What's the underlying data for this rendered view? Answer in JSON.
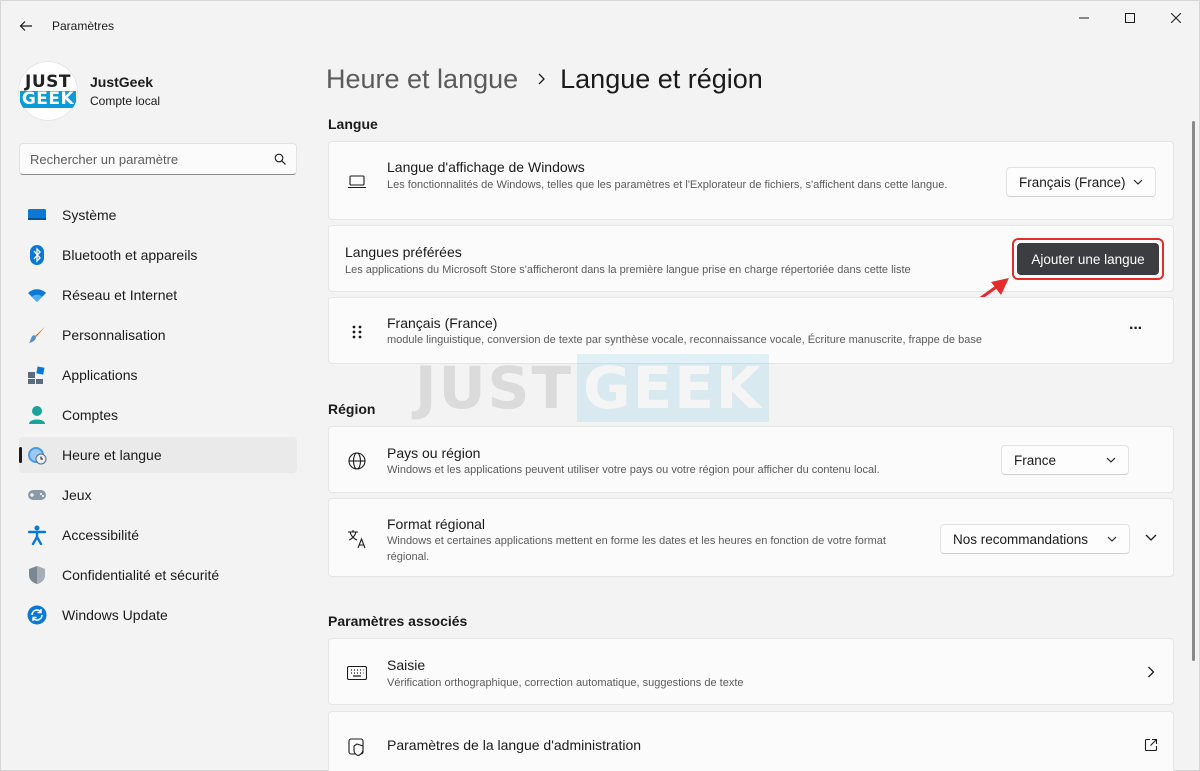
{
  "window": {
    "title": "Paramètres"
  },
  "profile": {
    "logo_top": "JUST",
    "logo_bottom": "GEEK",
    "name": "JustGeek",
    "account_type": "Compte local"
  },
  "search": {
    "placeholder": "Rechercher un paramètre"
  },
  "nav": {
    "items": [
      {
        "label": "Système",
        "icon": "system-icon"
      },
      {
        "label": "Bluetooth et appareils",
        "icon": "bluetooth-icon"
      },
      {
        "label": "Réseau et Internet",
        "icon": "wifi-icon"
      },
      {
        "label": "Personnalisation",
        "icon": "brush-icon"
      },
      {
        "label": "Applications",
        "icon": "apps-icon"
      },
      {
        "label": "Comptes",
        "icon": "account-icon"
      },
      {
        "label": "Heure et langue",
        "icon": "time-language-icon",
        "active": true
      },
      {
        "label": "Jeux",
        "icon": "gamepad-icon"
      },
      {
        "label": "Accessibilité",
        "icon": "accessibility-icon"
      },
      {
        "label": "Confidentialité et sécurité",
        "icon": "shield-icon"
      },
      {
        "label": "Windows Update",
        "icon": "update-icon"
      }
    ]
  },
  "breadcrumb": {
    "parent": "Heure et langue",
    "current": "Langue et région"
  },
  "sections": {
    "langue": "Langue",
    "region": "Région",
    "related": "Paramètres associés"
  },
  "display_language": {
    "title": "Langue d'affichage de Windows",
    "description": "Les fonctionnalités de Windows, telles que les paramètres et l'Explorateur de fichiers, s'affichent dans cette langue.",
    "value": "Français (France)"
  },
  "preferred_languages": {
    "title": "Langues préférées",
    "description": "Les applications du Microsoft Store s'afficheront dans la première langue prise en charge répertoriée dans cette liste",
    "add_button": "Ajouter une langue"
  },
  "installed_language": {
    "title": "Français (France)",
    "description": "module linguistique, conversion de texte par synthèse vocale, reconnaissance vocale, Écriture manuscrite, frappe de base",
    "more": "···"
  },
  "country": {
    "title": "Pays ou région",
    "description": "Windows et les applications peuvent utiliser votre pays ou votre région pour afficher du contenu local.",
    "value": "France"
  },
  "regional_format": {
    "title": "Format régional",
    "description": "Windows et certaines applications mettent en forme les dates et les heures en fonction de votre format régional.",
    "value": "Nos recommandations"
  },
  "typing": {
    "title": "Saisie",
    "description": "Vérification orthographique, correction automatique, suggestions de texte"
  },
  "admin_language": {
    "title": "Paramètres de la langue d'administration"
  },
  "watermark": {
    "part1": "JUST",
    "part2": "GEEK"
  },
  "colors": {
    "accent": "#0a9ad8",
    "highlight": "#e32d2d",
    "button": "#3b3d40"
  }
}
